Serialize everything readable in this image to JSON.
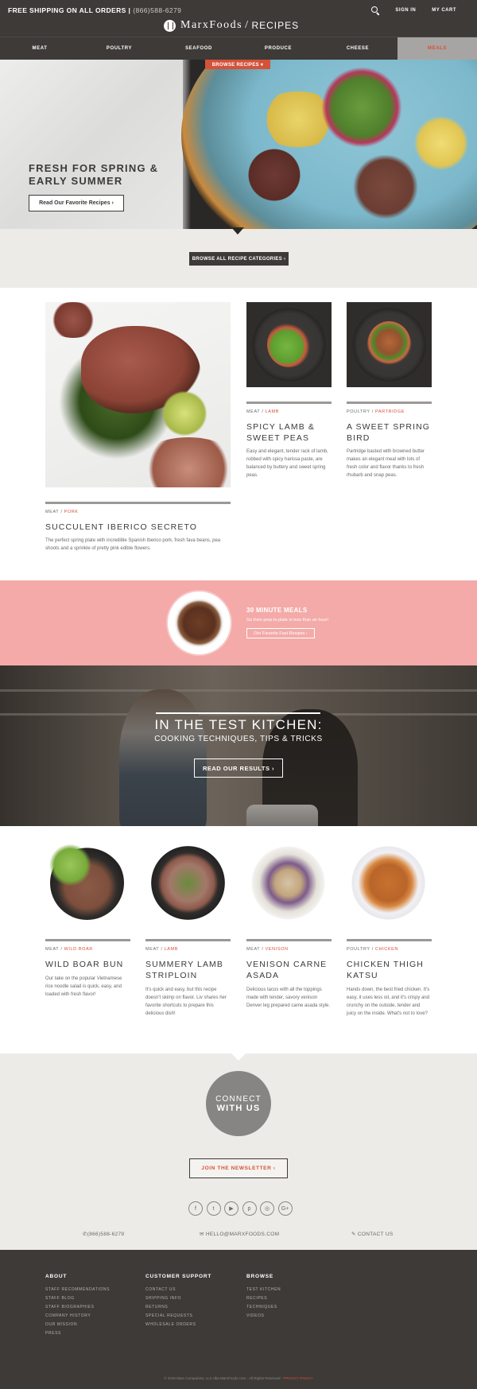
{
  "header": {
    "shipping_text": "FREE SHIPPING ON ALL ORDERS |",
    "phone": "(866)588-6279",
    "logo_brand": "MarxFoods",
    "logo_slash": "/",
    "logo_section": "RECIPES",
    "sign_in": "SIGN IN",
    "cart": "MY CART"
  },
  "nav": {
    "items": [
      "MEAT",
      "POULTRY",
      "SEAFOOD",
      "PRODUCE",
      "CHEESE",
      "MEALS"
    ],
    "active": "MEALS",
    "accent_color": "#d45239"
  },
  "hero": {
    "browse_tab": "BROWSE RECIPES ▾",
    "title": "FRESH FOR SPRING &\nEARLY SUMMER",
    "button": "Read Our Favorite Recipes ›"
  },
  "categories": {
    "button": "BROWSE ALL RECIPE CATEGORIES ›"
  },
  "featured": {
    "main": {
      "category": "MEAT",
      "sep": "/",
      "subcategory": "PORK",
      "title": "SUCCULENT IBERICO SECRETO",
      "desc": "The perfect spring plate with incredible Spanish Iberico pork, fresh fava beans, pea shoots and a sprinkle of pretty pink edible flowers."
    },
    "side": [
      {
        "category": "MEAT",
        "sep": "/",
        "subcategory": "LAMB",
        "title": "SPICY LAMB & SWEET PEAS",
        "desc": "Easy and elegant, tender rack of lamb, rubbed with spicy harissa paste, are balanced by buttery and sweet spring peas."
      },
      {
        "category": "POULTRY",
        "sep": "/",
        "subcategory": "PARTRIDGE",
        "title": "A SWEET SPRING BIRD",
        "desc": "Partridge basted with browned butter makes an elegant meal with lots of fresh color and flavor thanks to fresh rhubarb and snap peas."
      }
    ]
  },
  "quick_meals": {
    "title": "30 MINUTE MEALS",
    "subtitle": "Go from prep to plate in less than an hour!",
    "button": "Our Favorite Fast Recipes ›",
    "band_color": "#f3aaa8"
  },
  "test_kitchen": {
    "title": "IN THE TEST KITCHEN:",
    "subtitle": "COOKING TECHNIQUES, TIPS & TRICKS",
    "button": "READ OUR RESULTS ›"
  },
  "recipes": [
    {
      "category": "MEAT",
      "sep": "/",
      "subcategory": "WILD BOAR",
      "title": "WILD BOAR BUN",
      "desc": "Our take on the popular Vietnamese rice noodle salad is quick, easy, and loaded with fresh flavor!"
    },
    {
      "category": "MEAT",
      "sep": "/",
      "subcategory": "LAMB",
      "title": "SUMMERY LAMB STRIPLOIN",
      "desc": "It's quick and easy, but this recipe doesn't skimp on flavor. Liv shares her favorite shortcuts to prepare this delicious dish!"
    },
    {
      "category": "MEAT",
      "sep": "/",
      "subcategory": "VENISON",
      "title": "VENISON CARNE ASADA",
      "desc": "Delicious tacos with all the toppings made with tender, savory venison Denver leg prepared carne asada style."
    },
    {
      "category": "POULTRY",
      "sep": "/",
      "subcategory": "CHICKEN",
      "title": "CHICKEN THIGH KATSU",
      "desc": "Hands down, the best fried chicken. It's easy, it uses less oil, and it's crispy and crunchy on the outside, tender and juicy on the inside. What's not to love?"
    }
  ],
  "connect": {
    "line1": "CONNECT",
    "line2": "WITH US",
    "newsletter": "JOIN THE NEWSLETTER ›",
    "socials": [
      "f",
      "t",
      "▶",
      "p",
      "◎",
      "G+"
    ],
    "phone": "(866)588-6279",
    "email": "HELLO@MARXFOODS.COM",
    "contact": "CONTACT US"
  },
  "footer": {
    "about": {
      "heading": "ABOUT",
      "links": [
        "STAFF RECOMMENDATIONS",
        "STAFF BLOG",
        "STAFF BIOGRAPHIES",
        "COMPANY HISTORY",
        "OUR MISSION",
        "PRESS"
      ]
    },
    "support": {
      "heading": "CUSTOMER SUPPORT",
      "links": [
        "CONTACT US",
        "SHIPPING INFO",
        "RETURNS",
        "SPECIAL REQUESTS",
        "WHOLESALE ORDERS"
      ]
    },
    "browse": {
      "heading": "BROWSE",
      "links": [
        "TEST KITCHEN",
        "RECIPES",
        "TECHNIQUES",
        "VIDEOS"
      ]
    },
    "copyright": "© 2015 Marx Companies, LLC dba MarxFoods.com - All Rights Reserved -",
    "privacy": "PRIVACY POLICY"
  }
}
